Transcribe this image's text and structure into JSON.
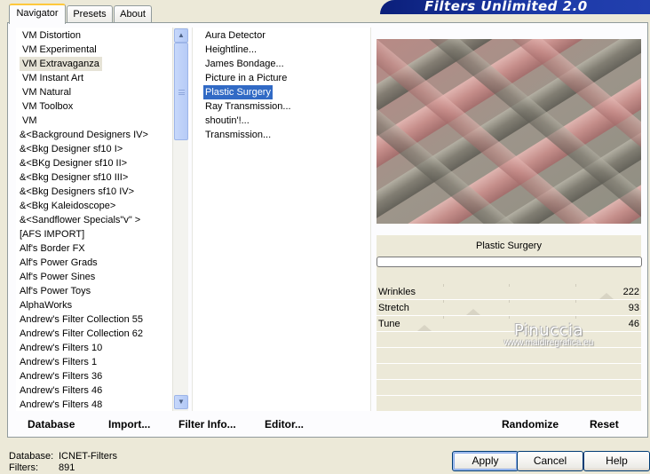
{
  "tabs": [
    {
      "label": "Navigator",
      "active": true
    },
    {
      "label": "Presets",
      "active": false
    },
    {
      "label": "About",
      "active": false
    }
  ],
  "banner_title": "Filters Unlimited 2.0",
  "categories": [
    "VM Distortion",
    "VM Experimental",
    "VM Extravaganza",
    "VM Instant Art",
    "VM Natural",
    "VM Toolbox",
    "VM"
  ],
  "selected_category": "VM Extravaganza",
  "filter_groups": [
    "&<Background Designers IV>",
    "&<Bkg Designer sf10 I>",
    "&<BKg Designer sf10 II>",
    "&<Bkg Designer sf10 III>",
    "&<Bkg Designers sf10 IV>",
    "&<Bkg Kaleidoscope>",
    "&<Sandflower Specials\"v\" >",
    "[AFS IMPORT]",
    "Alf's Border FX",
    "Alf's Power Grads",
    "Alf's Power Sines",
    "Alf's Power Toys",
    "AlphaWorks",
    "Andrew's Filter Collection 55",
    "Andrew's Filter Collection 62",
    "Andrew's Filters 10",
    "Andrew's Filters 1",
    "Andrew's Filters 36",
    "Andrew's Filters 46",
    "Andrew's Filters 48"
  ],
  "filters": [
    "Aura Detector",
    "Heightline...",
    "James Bondage...",
    "Picture in a Picture",
    "Plastic Surgery",
    "Ray Transmission...",
    "shoutin'!...",
    "Transmission..."
  ],
  "selected_filter": "Plastic Surgery",
  "current_filter_name": "Plastic Surgery",
  "progress": 0,
  "sliders": [
    {
      "label": "Wrinkles",
      "value": 222,
      "max": 255
    },
    {
      "label": "Stretch",
      "value": 93,
      "max": 255
    },
    {
      "label": "Tune",
      "value": 46,
      "max": 255
    }
  ],
  "watermark": {
    "name": "Pinuccia",
    "site": "www.maidiregrafica.eu"
  },
  "bottom_links": {
    "database": "Database",
    "import": "Import...",
    "filter_info": "Filter Info...",
    "editor": "Editor...",
    "randomize": "Randomize",
    "reset": "Reset"
  },
  "info": {
    "database_label": "Database:",
    "database_value": "ICNET-Filters",
    "filters_label": "Filters:",
    "filters_value": "891"
  },
  "buttons": {
    "apply": "Apply",
    "cancel": "Cancel",
    "help": "Help"
  },
  "colors": {
    "selection": "#316ac5",
    "banner": "#1c3aa8",
    "progress": "#2f8a2f"
  },
  "icons": {
    "scroll_up": "chevron-up-icon",
    "scroll_down": "chevron-down-icon"
  }
}
